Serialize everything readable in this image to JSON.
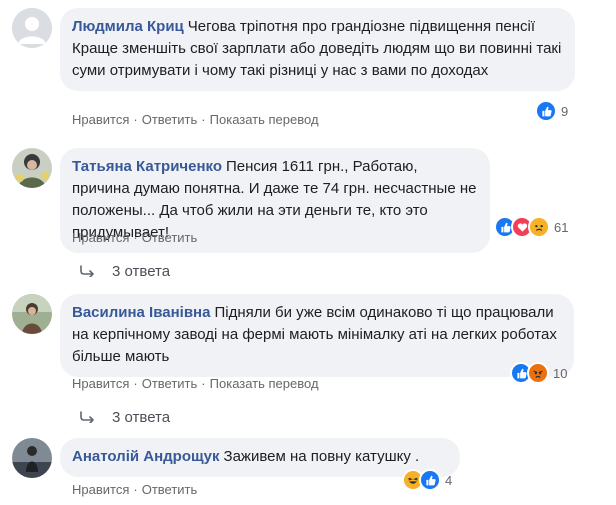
{
  "actions": {
    "like": "Нравится",
    "reply": "Ответить",
    "translate": "Показать перевод",
    "separator": "·"
  },
  "comments": [
    {
      "author": "Людмила Криц",
      "text": "Чегова тріпотня про грандіозне підвищення пенсії Краще зменшіть свої зарплати або доведіть людям що ви повинні такі суми отримувати і чому такі різниці у нас з вами по доходах",
      "reaction_count": "9",
      "reactions": [
        "like-icon"
      ],
      "has_translate": true
    },
    {
      "author": "Татьяна Катриченко",
      "text": "Пенсия 1611 грн., Работаю, причина думаю понятна. И даже те 74 грн. несчастные не положены... Да чтоб жили на эти деньги те, кто это придумывает!",
      "reaction_count": "61",
      "reactions": [
        "like-icon",
        "love-icon",
        "sad-icon"
      ],
      "has_translate": false,
      "replies": "3 ответа"
    },
    {
      "author": "Василина Іванівна",
      "text": "Підняли би уже всім одинаково ті що працювали на керпічному заводі на фермі мають мінімалку аті на легких роботах більше мають",
      "reaction_count": "10",
      "reactions": [
        "like-icon",
        "angry-icon"
      ],
      "has_translate": true,
      "replies": "3 ответа"
    },
    {
      "author": "Анатолій Андрощук",
      "text": "Заживем на повну катушку .",
      "reaction_count": "4",
      "reactions": [
        "haha-icon",
        "like-icon"
      ],
      "has_translate": false
    }
  ],
  "colors": {
    "author": "#385898",
    "bubble": "#f0f2f5",
    "meta": "#65676b",
    "like": "#1877f2",
    "love": "#f33e58",
    "angry": "#e9710f",
    "haha": "#f7b125"
  }
}
